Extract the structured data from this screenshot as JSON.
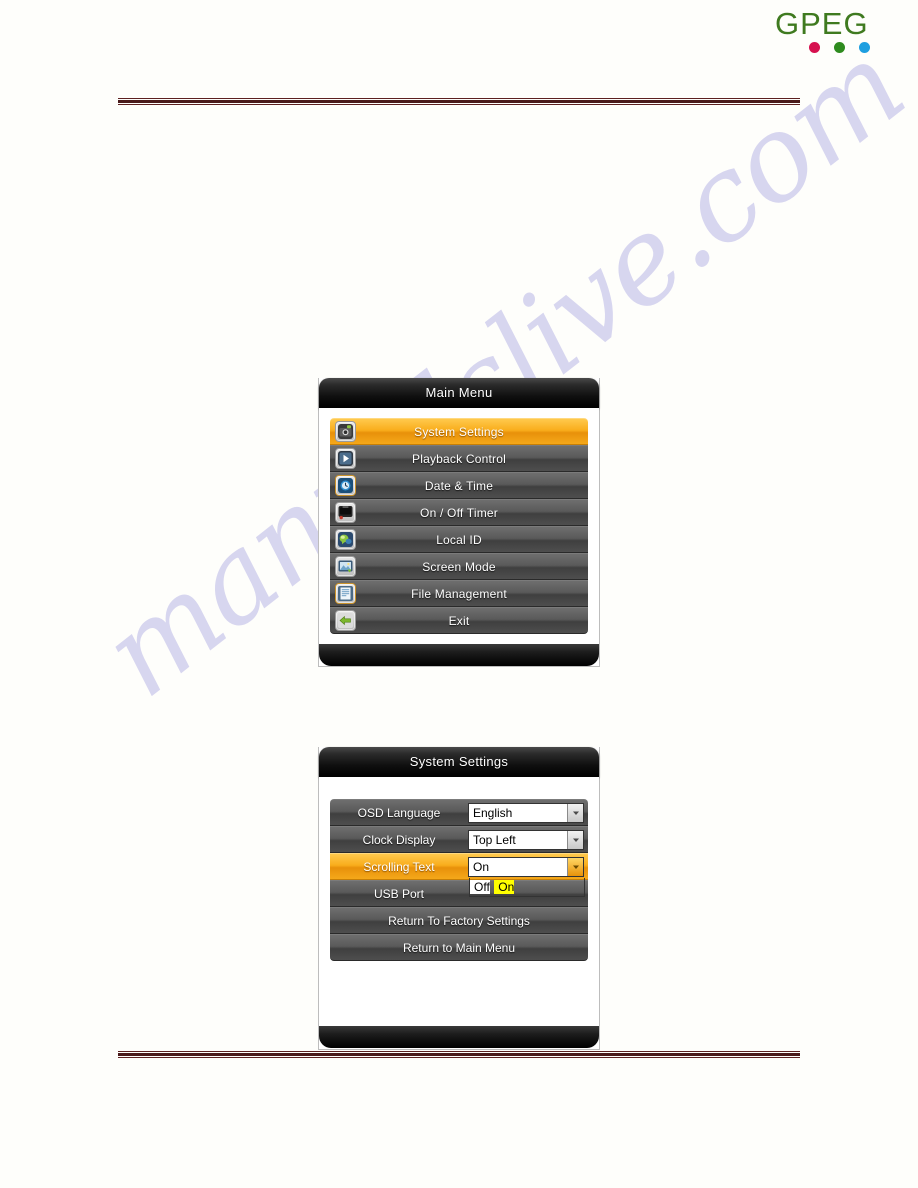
{
  "page": {
    "background_color": "#fefefb",
    "rule_color": "#4a1a1a"
  },
  "watermark": {
    "text": "manualslive.com",
    "color": "#b9b6e6"
  },
  "logo": {
    "word": "GPEG",
    "word_color": "#3f7a1f",
    "dots": [
      {
        "name": "dot-magenta",
        "color": "#d6114f"
      },
      {
        "name": "dot-green",
        "color": "#2e8b1e"
      },
      {
        "name": "dot-blue",
        "color": "#1e9fe0"
      }
    ]
  },
  "main_menu": {
    "title": "Main Menu",
    "items": [
      {
        "label": "System Settings",
        "icon": "camera-icon",
        "selected": true
      },
      {
        "label": "Playback Control",
        "icon": "play-icon",
        "selected": false
      },
      {
        "label": "Date & Time",
        "icon": "clock-icon",
        "selected": false
      },
      {
        "label": "On / Off Timer",
        "icon": "monitor-timer-icon",
        "selected": false
      },
      {
        "label": "Local ID",
        "icon": "speech-bubble-icon",
        "selected": false
      },
      {
        "label": "Screen Mode",
        "icon": "screen-image-icon",
        "selected": false
      },
      {
        "label": "File Management",
        "icon": "document-icon",
        "selected": false
      },
      {
        "label": "Exit",
        "icon": "back-arrow-icon",
        "selected": false
      }
    ]
  },
  "system_settings": {
    "title": "System Settings",
    "rows": [
      {
        "key": "OSD Language",
        "value": "English",
        "type": "combo",
        "selected": false,
        "open": false
      },
      {
        "key": "Clock Display",
        "value": "Top Left",
        "type": "combo",
        "selected": false,
        "open": false
      },
      {
        "key": "Scrolling Text",
        "value": "On",
        "type": "combo",
        "selected": true,
        "open": true,
        "options": [
          {
            "label": "Off",
            "active": false
          },
          {
            "label": "On",
            "active": true
          }
        ]
      },
      {
        "key": "USB Port",
        "value": "",
        "type": "combo-hidden",
        "selected": false,
        "open": false
      },
      {
        "key": "",
        "value": "",
        "type": "action",
        "label": "Return To Factory Settings",
        "selected": false
      },
      {
        "key": "",
        "value": "",
        "type": "action",
        "label": "Return to Main Menu",
        "selected": false
      }
    ]
  }
}
